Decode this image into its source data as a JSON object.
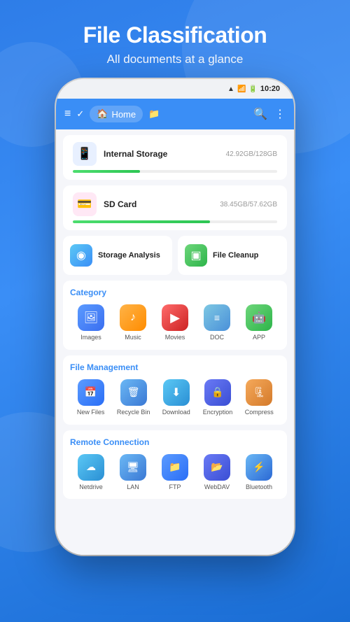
{
  "header": {
    "title": "File Classification",
    "subtitle": "All documents at a glance"
  },
  "status_bar": {
    "wifi": "📶",
    "signal": "📶",
    "battery": "🔋",
    "time": "10:20"
  },
  "toolbar": {
    "home_label": "Home"
  },
  "storage": [
    {
      "name": "Internal Storage",
      "used": "42.92GB",
      "total": "128GB",
      "percent": 33,
      "icon": "💾",
      "icon_class": "storage-icon-blue"
    },
    {
      "name": "SD Card",
      "used": "38.45GB",
      "total": "57.62GB",
      "percent": 67,
      "icon": "💳",
      "icon_class": "storage-icon-pink"
    }
  ],
  "utilities": [
    {
      "label": "Storage Analysis",
      "icon": "🔵",
      "icon_class": "utility-icon"
    },
    {
      "label": "File Cleanup",
      "icon": "🟢",
      "icon_class": "utility-icon"
    }
  ],
  "category": {
    "title": "Category",
    "items": [
      {
        "label": "Images",
        "icon": "🖼️",
        "icon_class": "icon-images"
      },
      {
        "label": "Music",
        "icon": "🎵",
        "icon_class": "icon-music"
      },
      {
        "label": "Movies",
        "icon": "▶️",
        "icon_class": "icon-movies"
      },
      {
        "label": "DOC",
        "icon": "☰",
        "icon_class": "icon-doc"
      },
      {
        "label": "APP",
        "icon": "🤖",
        "icon_class": "icon-app"
      }
    ]
  },
  "file_management": {
    "title": "File Management",
    "items": [
      {
        "label": "New Files",
        "icon": "📅",
        "icon_class": "icon-newfiles"
      },
      {
        "label": "Recycle Bin",
        "icon": "🗑️",
        "icon_class": "icon-recycle"
      },
      {
        "label": "Download",
        "icon": "⬇️",
        "icon_class": "icon-download"
      },
      {
        "label": "Encryption",
        "icon": "🔒",
        "icon_class": "icon-encryption"
      },
      {
        "label": "Compress",
        "icon": "🗜️",
        "icon_class": "icon-compress"
      }
    ]
  },
  "remote_connection": {
    "title": "Remote Connection",
    "items": [
      {
        "label": "Netdrive",
        "icon": "☁️",
        "icon_class": "icon-netdrive"
      },
      {
        "label": "LAN",
        "icon": "🖥️",
        "icon_class": "icon-lan"
      },
      {
        "label": "FTP",
        "icon": "📁",
        "icon_class": "icon-ftp"
      },
      {
        "label": "WebDAV",
        "icon": "📂",
        "icon_class": "icon-webdav"
      },
      {
        "label": "Bluetooth",
        "icon": "🔵",
        "icon_class": "icon-bluetooth"
      }
    ]
  }
}
